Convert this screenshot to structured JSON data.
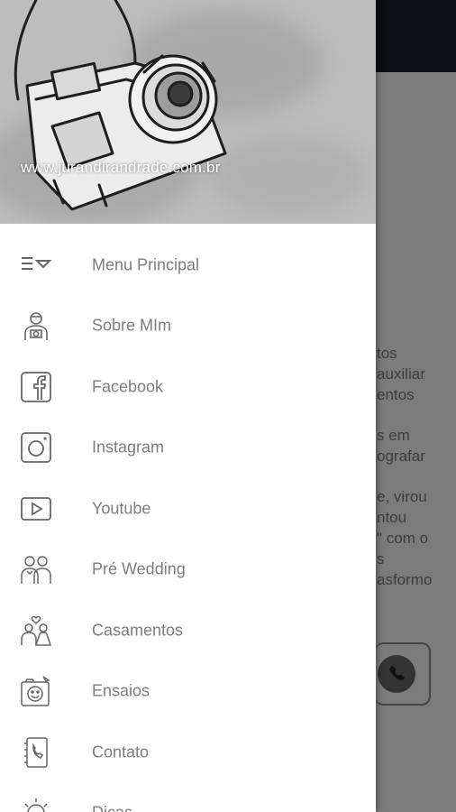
{
  "background": {
    "text_lines": [
      "tos",
      "auxiliar",
      "entos",
      "",
      "s em",
      "ografar",
      "",
      "e, virou",
      "ntou",
      "\" com o",
      "s",
      "asformo"
    ]
  },
  "drawer": {
    "header": {
      "url": "www.jurandirandrade.com.br"
    },
    "items": [
      {
        "label": "Menu Principal",
        "icon": "menu-icon"
      },
      {
        "label": "Sobre MIm",
        "icon": "photographer-icon"
      },
      {
        "label": "Facebook",
        "icon": "facebook-icon"
      },
      {
        "label": "Instagram",
        "icon": "instagram-icon"
      },
      {
        "label": "Youtube",
        "icon": "youtube-icon"
      },
      {
        "label": "Pré Wedding",
        "icon": "couple-icon"
      },
      {
        "label": "Casamentos",
        "icon": "wedding-icon"
      },
      {
        "label": "Ensaios",
        "icon": "photo-shoot-icon"
      },
      {
        "label": "Contato",
        "icon": "phone-book-icon"
      },
      {
        "label": "Dicas",
        "icon": "lightbulb-icon"
      }
    ]
  }
}
